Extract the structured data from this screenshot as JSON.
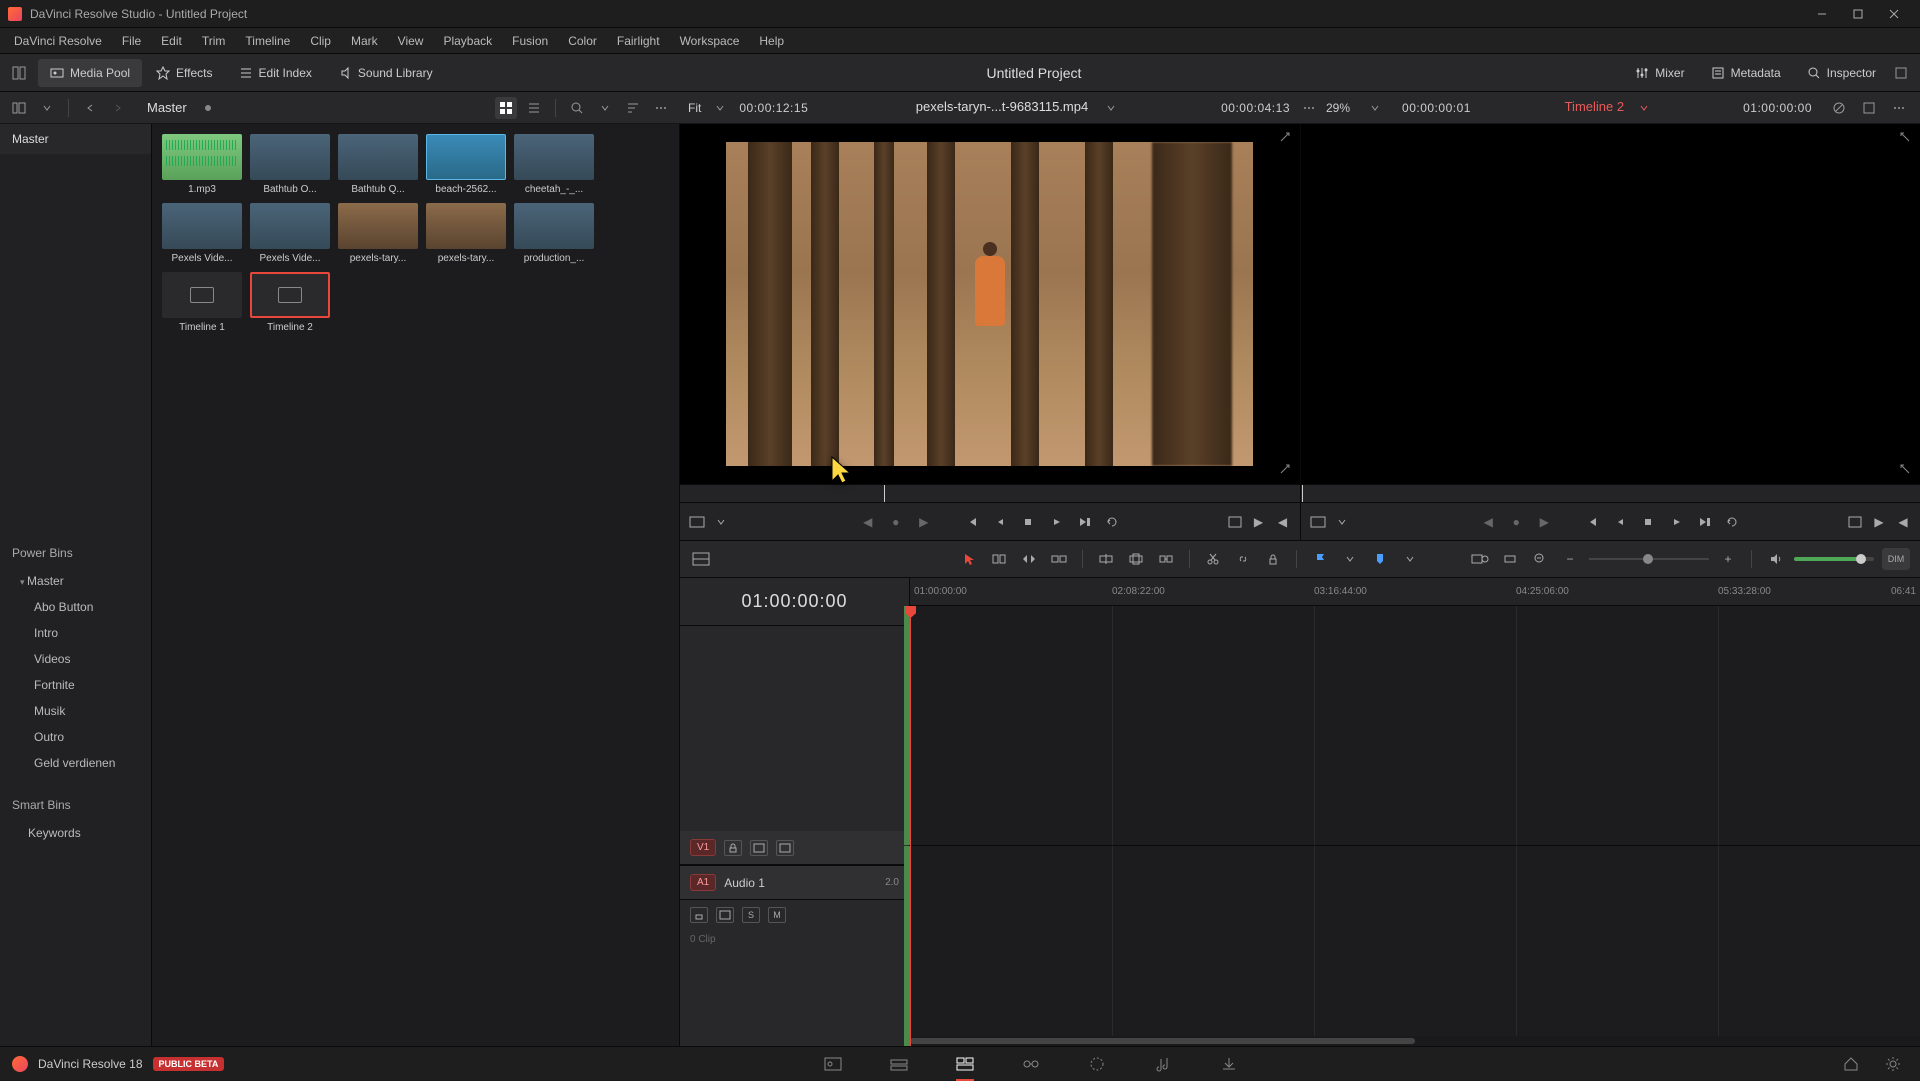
{
  "titlebar": {
    "title": "DaVinci Resolve Studio - Untitled Project"
  },
  "menubar": [
    "DaVinci Resolve",
    "File",
    "Edit",
    "Trim",
    "Timeline",
    "Clip",
    "Mark",
    "View",
    "Playback",
    "Fusion",
    "Color",
    "Fairlight",
    "Workspace",
    "Help"
  ],
  "toptoolbar": {
    "left": [
      {
        "id": "media-pool",
        "label": "Media Pool",
        "active": true
      },
      {
        "id": "effects",
        "label": "Effects",
        "active": false
      },
      {
        "id": "edit-index",
        "label": "Edit Index",
        "active": false
      },
      {
        "id": "sound-library",
        "label": "Sound Library",
        "active": false
      }
    ],
    "project": "Untitled Project",
    "right": [
      {
        "id": "mixer",
        "label": "Mixer"
      },
      {
        "id": "metadata",
        "label": "Metadata"
      },
      {
        "id": "inspector",
        "label": "Inspector"
      }
    ]
  },
  "subbar": {
    "breadcrumb": "Master",
    "source": {
      "fit": "Fit",
      "duration": "00:00:12:15",
      "clipname": "pexels-taryn-...t-9683115.mp4",
      "timecode": "00:00:04:13"
    },
    "program": {
      "zoom": "29%",
      "time": "00:00:00:01",
      "timeline": "Timeline 2",
      "timecode": "01:00:00:00"
    }
  },
  "sidebar": {
    "master": "Master",
    "powerbins": {
      "title": "Power Bins",
      "master": "Master",
      "items": [
        "Abo Button",
        "Intro",
        "Videos",
        "Fortnite",
        "Musik",
        "Outro",
        "Geld verdienen"
      ]
    },
    "smartbins": {
      "title": "Smart Bins",
      "items": [
        "Keywords"
      ]
    }
  },
  "clips": [
    {
      "label": "1.mp3",
      "type": "audio"
    },
    {
      "label": "Bathtub O...",
      "type": "video"
    },
    {
      "label": "Bathtub Q...",
      "type": "video"
    },
    {
      "label": "beach-2562...",
      "type": "video",
      "highlight": true
    },
    {
      "label": "cheetah_-_...",
      "type": "video"
    },
    {
      "label": "Pexels Vide...",
      "type": "video"
    },
    {
      "label": "Pexels Vide...",
      "type": "video"
    },
    {
      "label": "pexels-tary...",
      "type": "forest"
    },
    {
      "label": "pexels-tary...",
      "type": "forest"
    },
    {
      "label": "production_...",
      "type": "video"
    },
    {
      "label": "Timeline 1",
      "type": "timeline"
    },
    {
      "label": "Timeline 2",
      "type": "timeline",
      "selected": true
    }
  ],
  "timeline": {
    "bigTimecode": "01:00:00:00",
    "ruler": [
      "01:00:00:00",
      "02:08:22:00",
      "03:16:44:00",
      "04:25:06:00",
      "05:33:28:00",
      "06:41"
    ],
    "videoTrack": {
      "badge": "V1"
    },
    "audioTrack": {
      "badge": "A1",
      "name": "Audio 1",
      "channels": "2.0",
      "clips": "0 Clip",
      "buttons": [
        "S",
        "M"
      ]
    }
  },
  "bottombar": {
    "app": "DaVinci Resolve 18",
    "beta": "PUBLIC BETA"
  }
}
